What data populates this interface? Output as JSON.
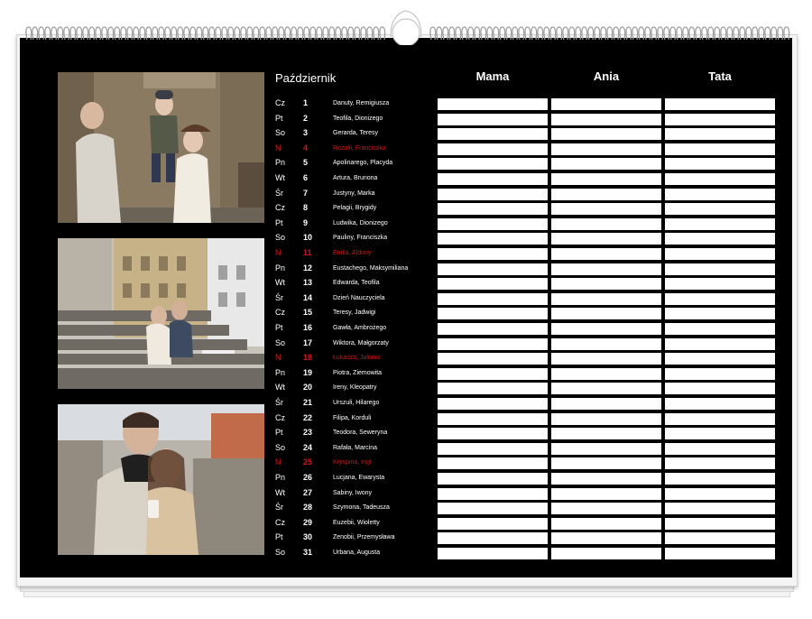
{
  "calendar": {
    "month": "Październik",
    "people": [
      "Mama",
      "Ania",
      "Tata"
    ],
    "days": [
      {
        "dow": "Cz",
        "day": "1",
        "names": "Danuty, Remigiusza",
        "sunday": false
      },
      {
        "dow": "Pt",
        "day": "2",
        "names": "Teofila, Dionizego",
        "sunday": false
      },
      {
        "dow": "So",
        "day": "3",
        "names": "Gerarda, Teresy",
        "sunday": false
      },
      {
        "dow": "N",
        "day": "4",
        "names": "Rozalii, Franciszka",
        "sunday": true
      },
      {
        "dow": "Pn",
        "day": "5",
        "names": "Apolinarego, Placyda",
        "sunday": false
      },
      {
        "dow": "Wt",
        "day": "6",
        "names": "Artura, Brunona",
        "sunday": false
      },
      {
        "dow": "Śr",
        "day": "7",
        "names": "Justyny, Marka",
        "sunday": false
      },
      {
        "dow": "Cz",
        "day": "8",
        "names": "Pelagii, Brygidy",
        "sunday": false
      },
      {
        "dow": "Pt",
        "day": "9",
        "names": "Ludwika, Dionizego",
        "sunday": false
      },
      {
        "dow": "So",
        "day": "10",
        "names": "Pauliny, Franciszka",
        "sunday": false
      },
      {
        "dow": "N",
        "day": "11",
        "names": "Emila, Aldony",
        "sunday": true
      },
      {
        "dow": "Pn",
        "day": "12",
        "names": "Eustachego, Maksymiliana",
        "sunday": false
      },
      {
        "dow": "Wt",
        "day": "13",
        "names": "Edwarda, Teofila",
        "sunday": false
      },
      {
        "dow": "Śr",
        "day": "14",
        "names": "Dzień Nauczyciela",
        "sunday": false
      },
      {
        "dow": "Cz",
        "day": "15",
        "names": "Teresy, Jadwigi",
        "sunday": false
      },
      {
        "dow": "Pt",
        "day": "16",
        "names": "Gawła, Ambrożego",
        "sunday": false
      },
      {
        "dow": "So",
        "day": "17",
        "names": "Wiktora, Małgorzaty",
        "sunday": false
      },
      {
        "dow": "N",
        "day": "18",
        "names": "Łukasza, Juliana",
        "sunday": true
      },
      {
        "dow": "Pn",
        "day": "19",
        "names": "Piotra, Ziemowita",
        "sunday": false
      },
      {
        "dow": "Wt",
        "day": "20",
        "names": "Ireny, Kleopatry",
        "sunday": false
      },
      {
        "dow": "Śr",
        "day": "21",
        "names": "Urszuli, Hilarego",
        "sunday": false
      },
      {
        "dow": "Cz",
        "day": "22",
        "names": "Filipa, Korduli",
        "sunday": false
      },
      {
        "dow": "Pt",
        "day": "23",
        "names": "Teodora, Seweryna",
        "sunday": false
      },
      {
        "dow": "So",
        "day": "24",
        "names": "Rafała, Marcina",
        "sunday": false
      },
      {
        "dow": "N",
        "day": "25",
        "names": "Kryspina, Ingi",
        "sunday": true
      },
      {
        "dow": "Pn",
        "day": "26",
        "names": "Lucjana, Ewarysta",
        "sunday": false
      },
      {
        "dow": "Wt",
        "day": "27",
        "names": "Sabiny, Iwony",
        "sunday": false
      },
      {
        "dow": "Śr",
        "day": "28",
        "names": "Szymona, Tadeusza",
        "sunday": false
      },
      {
        "dow": "Cz",
        "day": "29",
        "names": "Euzebii, Wioletty",
        "sunday": false
      },
      {
        "dow": "Pt",
        "day": "30",
        "names": "Zenobii, Przemysława",
        "sunday": false
      },
      {
        "dow": "So",
        "day": "31",
        "names": "Urbana, Augusta",
        "sunday": false
      }
    ]
  },
  "colors": {
    "background": "#000000",
    "text": "#ffffff",
    "sunday": "#d01818",
    "cell": "#ffffff"
  },
  "photos": [
    {
      "subject": "family-with-child-photo"
    },
    {
      "subject": "couple-on-steps-photo"
    },
    {
      "subject": "couple-closeup-photo"
    }
  ]
}
